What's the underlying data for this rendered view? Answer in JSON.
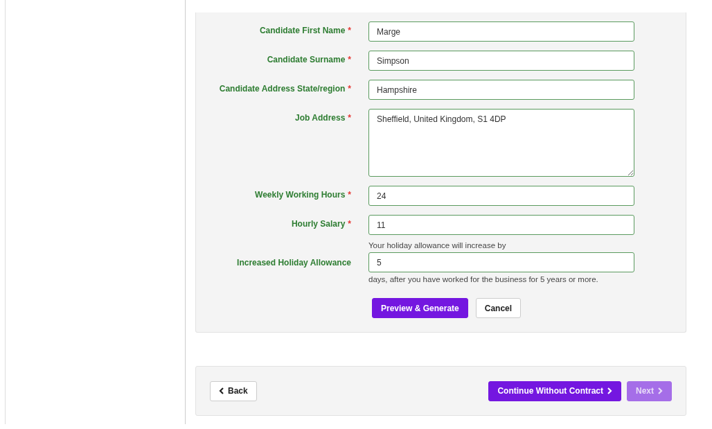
{
  "fields": [
    {
      "kind": "input",
      "label": "Candidate First Name",
      "required": true,
      "value": "Marge"
    },
    {
      "kind": "input",
      "label": "Candidate Surname",
      "required": true,
      "value": "Simpson"
    },
    {
      "kind": "input",
      "label": "Candidate Address State/region",
      "required": true,
      "value": "Hampshire"
    },
    {
      "kind": "textarea",
      "label": "Job Address",
      "required": true,
      "value": "Sheffield, United Kingdom, S1 4DP"
    },
    {
      "kind": "input",
      "label": "Weekly Working Hours",
      "required": true,
      "value": "24"
    },
    {
      "kind": "input",
      "label": "Hourly Salary",
      "required": true,
      "value": "11"
    },
    {
      "kind": "holiday",
      "label": "Increased Holiday Allowance",
      "required": false,
      "before": "Your holiday allowance will increase by",
      "value": "5",
      "after": "days, after you have worked for the business for 5 years or more."
    }
  ],
  "required_mark": "*",
  "form_buttons": [
    {
      "label": "Preview & Generate",
      "kind": "primary"
    },
    {
      "label": "Cancel",
      "kind": "secondary"
    }
  ],
  "nav": {
    "back": {
      "label": "Back"
    },
    "continue": {
      "label": "Continue Without Contract",
      "disabled": false
    },
    "next": {
      "label": "Next",
      "disabled": true
    }
  }
}
